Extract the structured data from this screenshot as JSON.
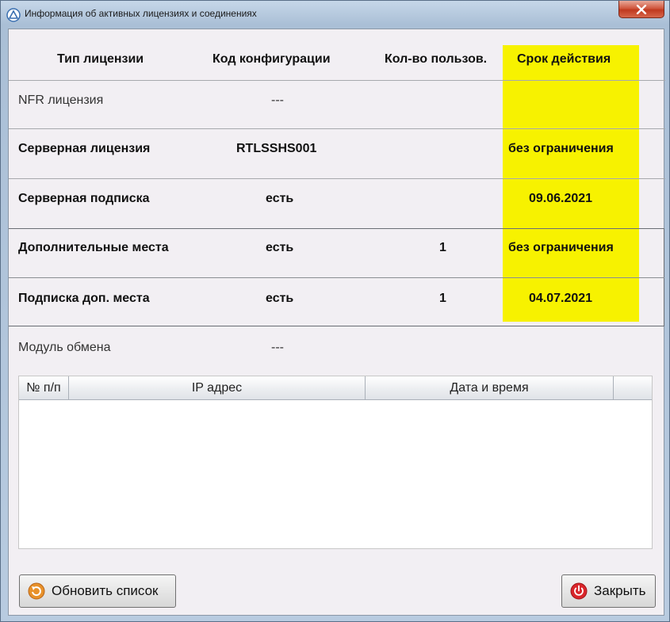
{
  "window": {
    "title": "Информация об активных лицензиях и соединениях",
    "close_glyph": "x"
  },
  "license_table": {
    "headers": [
      "Тип лицензии",
      "Код конфигурации",
      "Кол-во пользов.",
      "Срок действия"
    ],
    "rows": [
      {
        "type": "NFR лицензия",
        "config": "---",
        "users": "",
        "expiry": ""
      },
      {
        "type": "Серверная лицензия",
        "config": "RTLSSHS001",
        "users": "",
        "expiry": "без ограничения"
      },
      {
        "type": "Серверная подписка",
        "config": "есть",
        "users": "",
        "expiry": "09.06.2021"
      },
      {
        "type": "Дополнительные места",
        "config": "есть",
        "users": "1",
        "expiry": "без ограничения"
      },
      {
        "type": "Подписка доп. места",
        "config": "есть",
        "users": "1",
        "expiry": "04.07.2021"
      }
    ],
    "highlight_color": "#f7f200"
  },
  "exchange_module": {
    "label": "Модуль обмена",
    "value": "---"
  },
  "sessions_table": {
    "headers": [
      "№ п/п",
      "IP адрес",
      "Дата и время",
      ""
    ],
    "rows": []
  },
  "buttons": {
    "refresh_label": "Обновить список",
    "refresh_icon": "refresh-icon",
    "close_label": "Закрыть",
    "close_icon": "power-icon"
  }
}
